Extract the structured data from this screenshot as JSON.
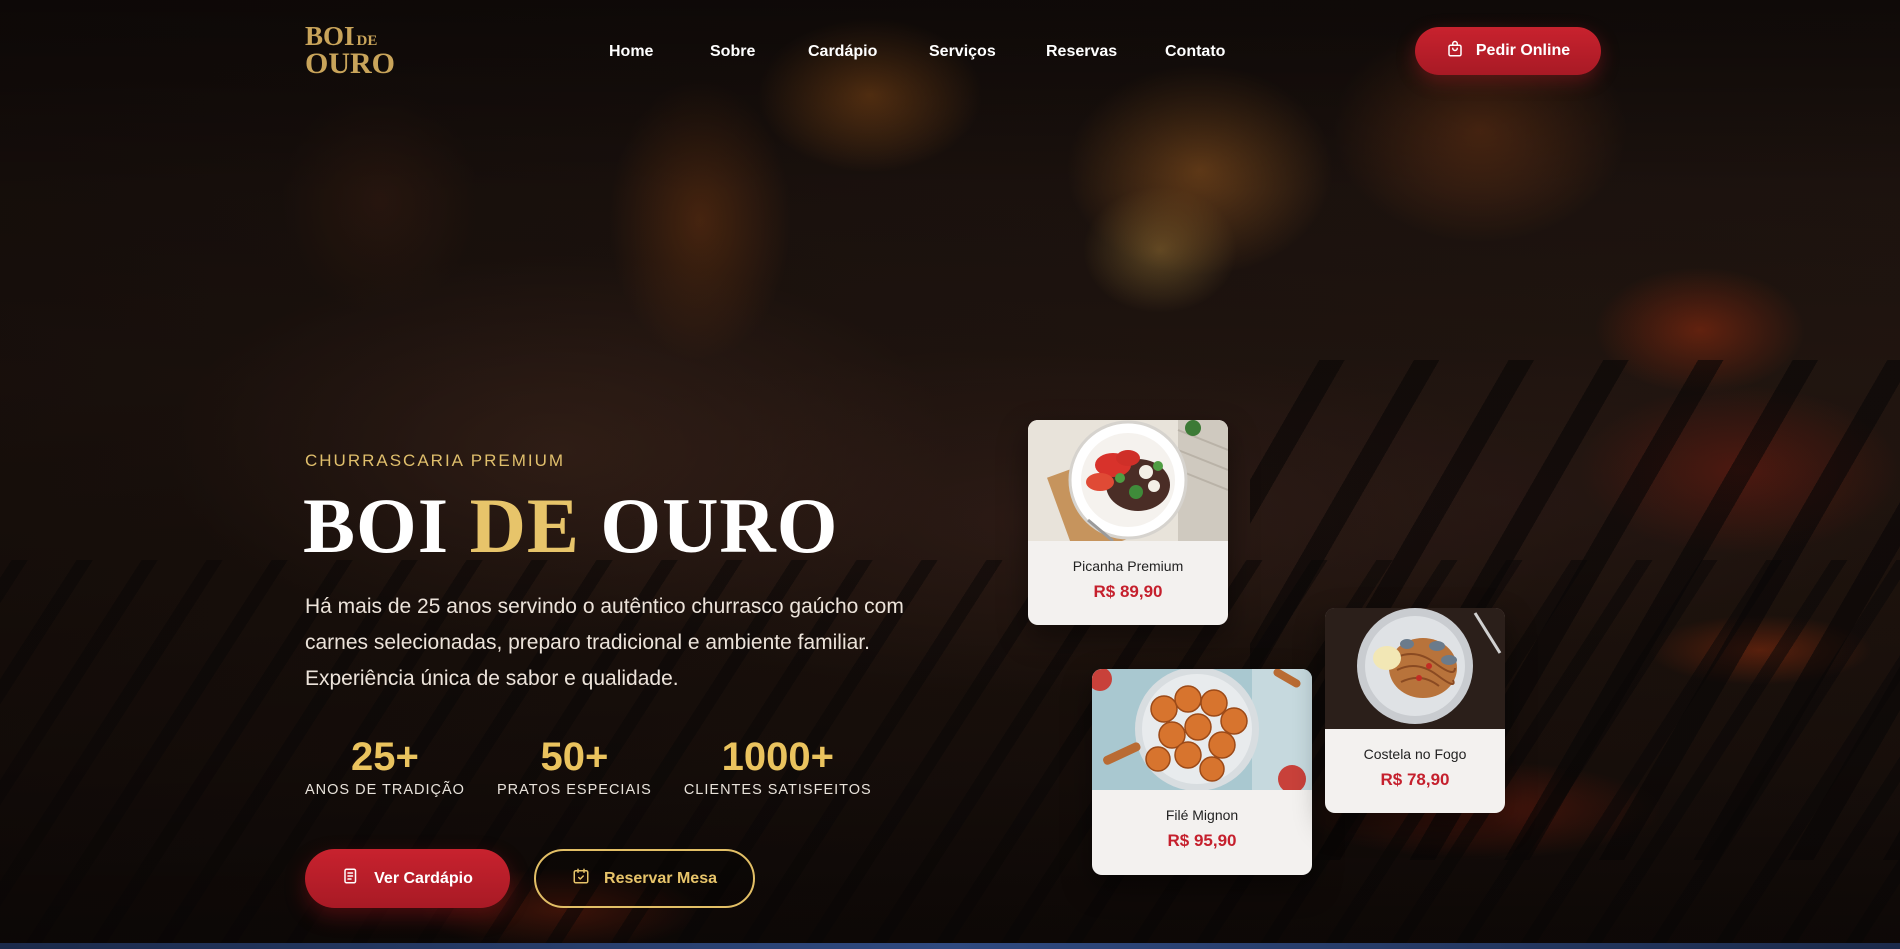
{
  "header": {
    "logo": {
      "line1": "BOI",
      "line1_small": "DE",
      "line2": "OURO"
    },
    "nav": [
      {
        "label": "Home"
      },
      {
        "label": "Sobre"
      },
      {
        "label": "Cardápio"
      },
      {
        "label": "Serviços"
      },
      {
        "label": "Reservas"
      },
      {
        "label": "Contato"
      }
    ],
    "order_button": {
      "label": "Pedir Online",
      "icon": "shopping-bag-icon"
    }
  },
  "hero": {
    "eyebrow": "CHURRASCARIA PREMIUM",
    "title": {
      "part1": "BOI ",
      "part2": "DE",
      "part3": " OURO"
    },
    "description": "Há mais de 25 anos servindo o autêntico churrasco gaúcho com carnes selecionadas, preparo tradicional e ambiente familiar. Experiência única de sabor e qualidade.",
    "stats": [
      {
        "value": "25+",
        "label": "ANOS DE TRADIÇÃO"
      },
      {
        "value": "50+",
        "label": "PRATOS ESPECIAIS"
      },
      {
        "value": "1000+",
        "label": "CLIENTES SATISFEITOS"
      }
    ],
    "buttons": {
      "menu": {
        "label": "Ver Cardápio",
        "icon": "menu-list-icon"
      },
      "reserve": {
        "label": "Reservar Mesa",
        "icon": "calendar-check-icon"
      }
    }
  },
  "cards": [
    {
      "name": "Picanha Premium",
      "price": "R$ 89,90"
    },
    {
      "name": "Filé Mignon",
      "price": "R$ 95,90"
    },
    {
      "name": "Costela no Fogo",
      "price": "R$ 78,90"
    }
  ],
  "colors": {
    "accent_red": "#c8222e",
    "accent_gold": "#e7c46a",
    "price_red": "#c5202d"
  }
}
